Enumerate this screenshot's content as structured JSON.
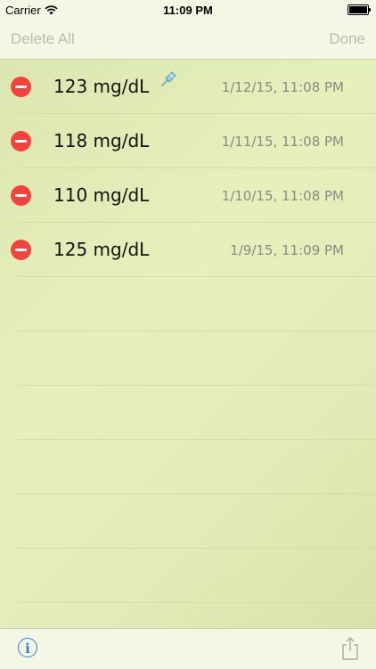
{
  "status_bar": {
    "carrier": "Carrier",
    "time": "11:09 PM",
    "wifi_icon": "wifi-icon",
    "battery_icon": "battery-icon"
  },
  "nav": {
    "left_label": "Delete All",
    "right_label": "Done"
  },
  "readings": [
    {
      "value": "123 mg/dL",
      "timestamp": "1/12/15, 11:08 PM",
      "pinned": true
    },
    {
      "value": "118 mg/dL",
      "timestamp": "1/11/15, 11:08 PM",
      "pinned": false
    },
    {
      "value": "110 mg/dL",
      "timestamp": "1/10/15, 11:08 PM",
      "pinned": false
    },
    {
      "value": "125 mg/dL",
      "timestamp": "1/9/15, 11:09 PM",
      "pinned": false
    }
  ],
  "toolbar": {
    "info_icon": "info-icon",
    "share_icon": "share-icon",
    "info_glyph": "i"
  },
  "colors": {
    "accent": "#2f7fd8",
    "delete": "#f4423c",
    "background": "#e6f0bc"
  }
}
